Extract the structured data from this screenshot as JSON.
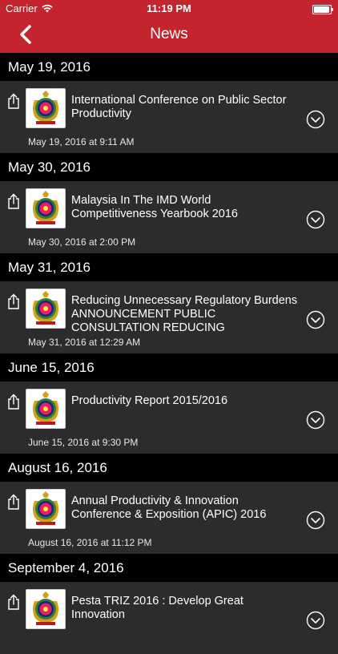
{
  "status_bar": {
    "carrier": "Carrier",
    "time": "11:19 PM"
  },
  "nav": {
    "title": "News"
  },
  "sections": [
    {
      "date": "May 19, 2016",
      "headline": "International Conference on Public Sector Productivity",
      "timestamp": "May 19, 2016 at 9:11 AM"
    },
    {
      "date": "May 30, 2016",
      "headline": "Malaysia In The IMD World Competitiveness Yearbook 2016",
      "timestamp": "May 30, 2016 at 2:00 PM"
    },
    {
      "date": "May 31, 2016",
      "headline": "Reducing Unnecessary Regulatory Burdens ANNOUNCEMENT PUBLIC CONSULTATION REDUCING",
      "timestamp": "May 31, 2016 at 12:29 AM"
    },
    {
      "date": "June 15, 2016",
      "headline": "Productivity Report 2015/2016",
      "timestamp": "June 15, 2016 at 9:30 PM"
    },
    {
      "date": "August 16, 2016",
      "headline": "Annual Productivity & Innovation Conference & Exposition (APIC) 2016",
      "timestamp": "August 16, 2016 at 11:12 PM"
    },
    {
      "date": "September 4, 2016",
      "headline": "Pesta TRIZ 2016 : Develop Great Innovation",
      "timestamp": ""
    }
  ],
  "colors": {
    "accent": "#c4242e",
    "card": "#2c2c2e",
    "header": "#000000"
  },
  "icons": {
    "back": "chevron-left-icon",
    "share": "share-icon",
    "expand": "chevron-down-circle-icon",
    "logo": "organization-logo"
  }
}
